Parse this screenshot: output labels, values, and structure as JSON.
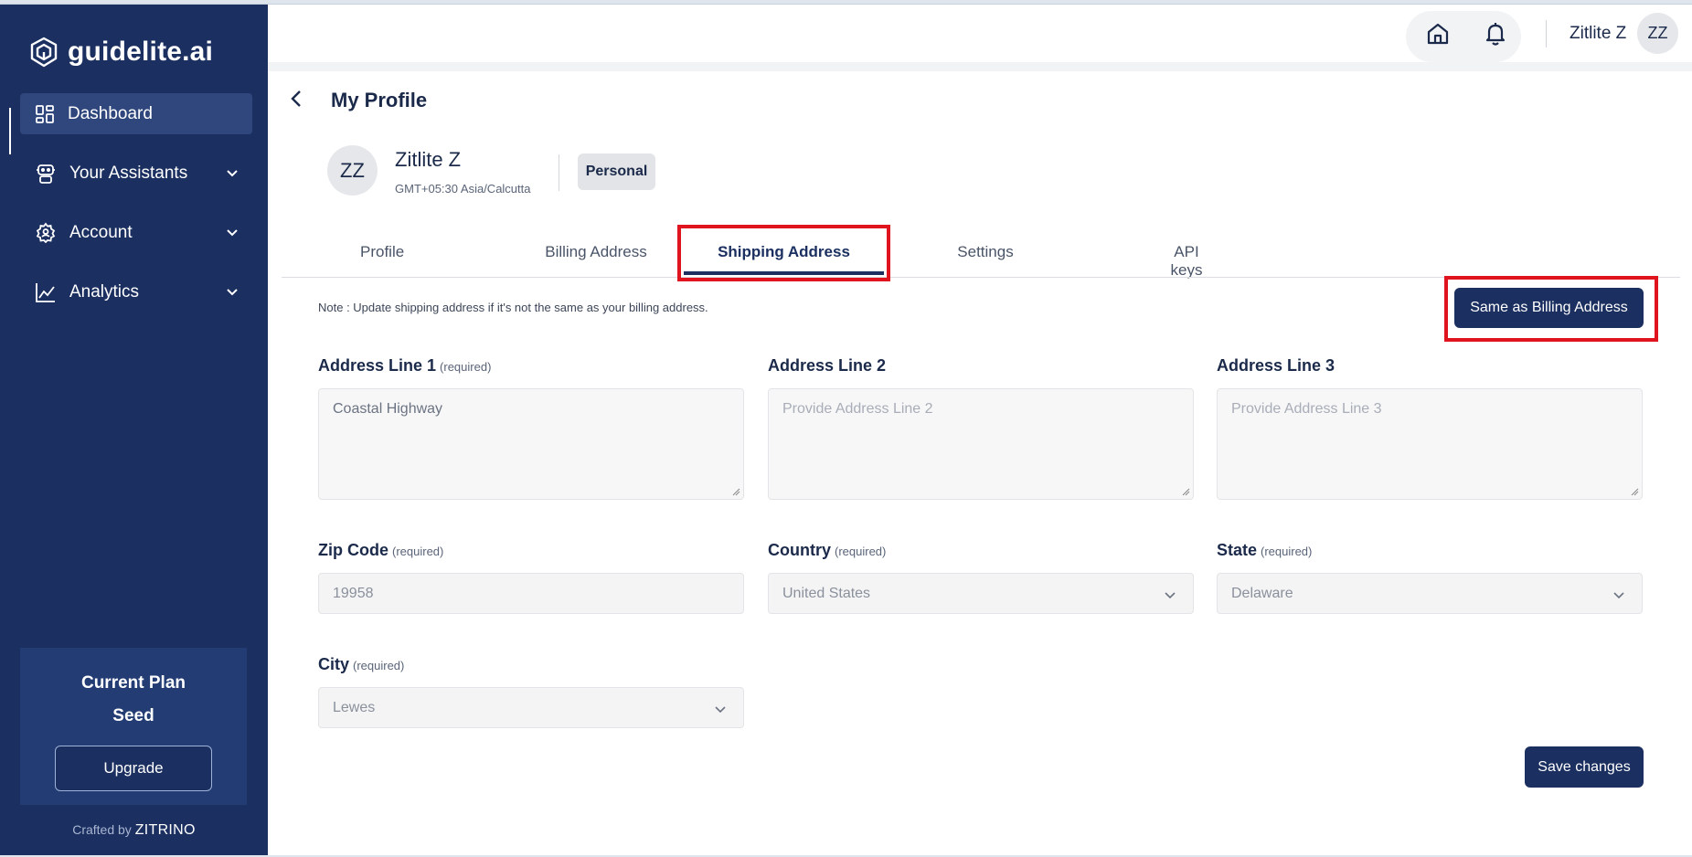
{
  "brand": {
    "name": "guidelite.ai"
  },
  "sidebar": {
    "items": [
      {
        "label": "Dashboard"
      },
      {
        "label": "Your Assistants"
      },
      {
        "label": "Account"
      },
      {
        "label": "Analytics"
      }
    ],
    "plan": {
      "title": "Current Plan",
      "name": "Seed",
      "upgrade_label": "Upgrade"
    },
    "crafted_prefix": "Crafted by",
    "crafted_brand": "ZITRINO"
  },
  "topbar": {
    "user_name": "Zitlite Z",
    "avatar_initials": "ZZ"
  },
  "page": {
    "title": "My Profile"
  },
  "profile": {
    "initials": "ZZ",
    "name": "Zitlite Z",
    "timezone": "GMT+05:30 Asia/Calcutta",
    "badge": "Personal"
  },
  "tabs": [
    {
      "label": "Profile"
    },
    {
      "label": "Billing Address"
    },
    {
      "label": "Shipping Address"
    },
    {
      "label": "Settings"
    },
    {
      "label": "API keys"
    }
  ],
  "active_tab": "Shipping Address",
  "note": "Note : Update shipping address if it's not the same as your billing address.",
  "same_as_billing_label": "Same as Billing Address",
  "form": {
    "address1": {
      "label": "Address Line 1",
      "required": "(required)",
      "value": "Coastal Highway"
    },
    "address2": {
      "label": "Address Line 2",
      "placeholder": "Provide Address Line 2"
    },
    "address3": {
      "label": "Address Line 3",
      "placeholder": "Provide Address Line 3"
    },
    "zip": {
      "label": "Zip Code",
      "required": "(required)",
      "value": "19958"
    },
    "country": {
      "label": "Country",
      "required": "(required)",
      "value": "United States"
    },
    "state": {
      "label": "State",
      "required": "(required)",
      "value": "Delaware"
    },
    "city": {
      "label": "City",
      "required": "(required)",
      "value": "Lewes"
    }
  },
  "save_label": "Save changes",
  "colors": {
    "primary": "#1b2f60",
    "highlight": "#e0141e",
    "active_nav": "#2f477d"
  }
}
